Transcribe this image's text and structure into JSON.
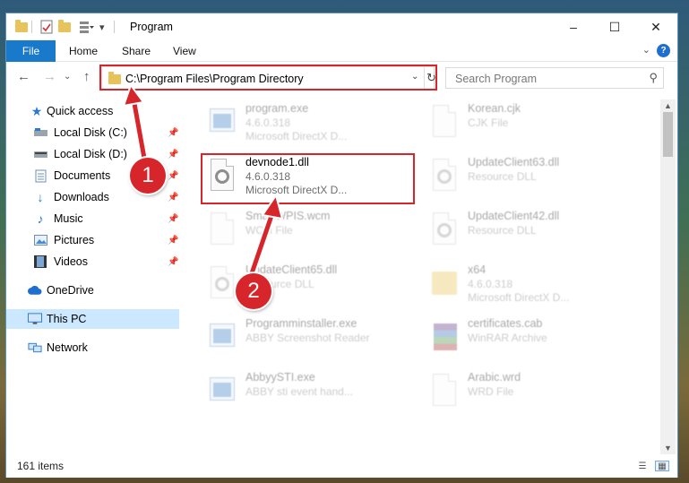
{
  "window": {
    "title": "Program",
    "controls": {
      "minimize": "–",
      "maximize": "☐",
      "close": "✕"
    }
  },
  "quick_access_toolbar": {
    "icons": [
      "folder-icon",
      "properties-icon",
      "new-folder-icon",
      "customize-icon"
    ]
  },
  "ribbon": {
    "tabs": [
      "File",
      "Home",
      "Share",
      "View"
    ],
    "help": "?"
  },
  "navigation": {
    "address": "C:\\Program Files\\Program Directory",
    "search_placeholder": "Search Program"
  },
  "sidebar": {
    "items": [
      {
        "label": "Quick access",
        "icon": "star-icon",
        "pinned": false
      },
      {
        "label": "Local Disk (C:)",
        "icon": "drive-icon",
        "pinned": true
      },
      {
        "label": "Local Disk (D:)",
        "icon": "drive-icon",
        "pinned": true
      },
      {
        "label": "Documents",
        "icon": "documents-icon",
        "pinned": true
      },
      {
        "label": "Downloads",
        "icon": "downloads-icon",
        "pinned": true
      },
      {
        "label": "Music",
        "icon": "music-icon",
        "pinned": true
      },
      {
        "label": "Pictures",
        "icon": "pictures-icon",
        "pinned": true
      },
      {
        "label": "Videos",
        "icon": "videos-icon",
        "pinned": true
      },
      {
        "label": "OneDrive",
        "icon": "onedrive-icon",
        "pinned": false
      },
      {
        "label": "This PC",
        "icon": "this-pc-icon",
        "pinned": false,
        "selected": true
      },
      {
        "label": "Network",
        "icon": "network-icon",
        "pinned": false
      }
    ]
  },
  "files": [
    {
      "name": "program.exe",
      "line2": "4.6.0.318",
      "line3": "Microsoft DirectX D...",
      "icon": "exe-icon"
    },
    {
      "name": "Korean.cjk",
      "line2": "CJK File",
      "line3": "",
      "icon": "document-icon"
    },
    {
      "name": "devnode1.dll",
      "line2": "4.6.0.318",
      "line3": "Microsoft DirectX D...",
      "icon": "dll-icon"
    },
    {
      "name": "UpdateClient63.dll",
      "line2": "Resource DLL",
      "line3": "",
      "icon": "dll-icon"
    },
    {
      "name": "SmartWPIS.wcm",
      "line2": "WCM File",
      "line3": "",
      "icon": "document-icon"
    },
    {
      "name": "UpdateClient42.dll",
      "line2": "Resource DLL",
      "line3": "",
      "icon": "dll-icon"
    },
    {
      "name": "UpdateClient65.dll",
      "line2": "Resource DLL",
      "line3": "",
      "icon": "dll-icon"
    },
    {
      "name": "x64",
      "line2": "4.6.0.318",
      "line3": "Microsoft DirectX D...",
      "icon": "folder-icon"
    },
    {
      "name": "Programminstaller.exe",
      "line2": "ABBY Screenshot Reader",
      "line3": "",
      "icon": "exe-icon"
    },
    {
      "name": "certificates.cab",
      "line2": "WinRAR Archive",
      "line3": "",
      "icon": "archive-icon"
    },
    {
      "name": "AbbyySTI.exe",
      "line2": "ABBY sti event hand...",
      "line3": "",
      "icon": "exe-icon"
    },
    {
      "name": "Arabic.wrd",
      "line2": "WRD File",
      "line3": "",
      "icon": "document-icon"
    }
  ],
  "status": {
    "count": "161 items"
  },
  "callouts": [
    "1",
    "2"
  ],
  "colors": {
    "accent": "#1979ca",
    "highlight": "#d6262b",
    "selected_bg": "#cce8ff"
  }
}
